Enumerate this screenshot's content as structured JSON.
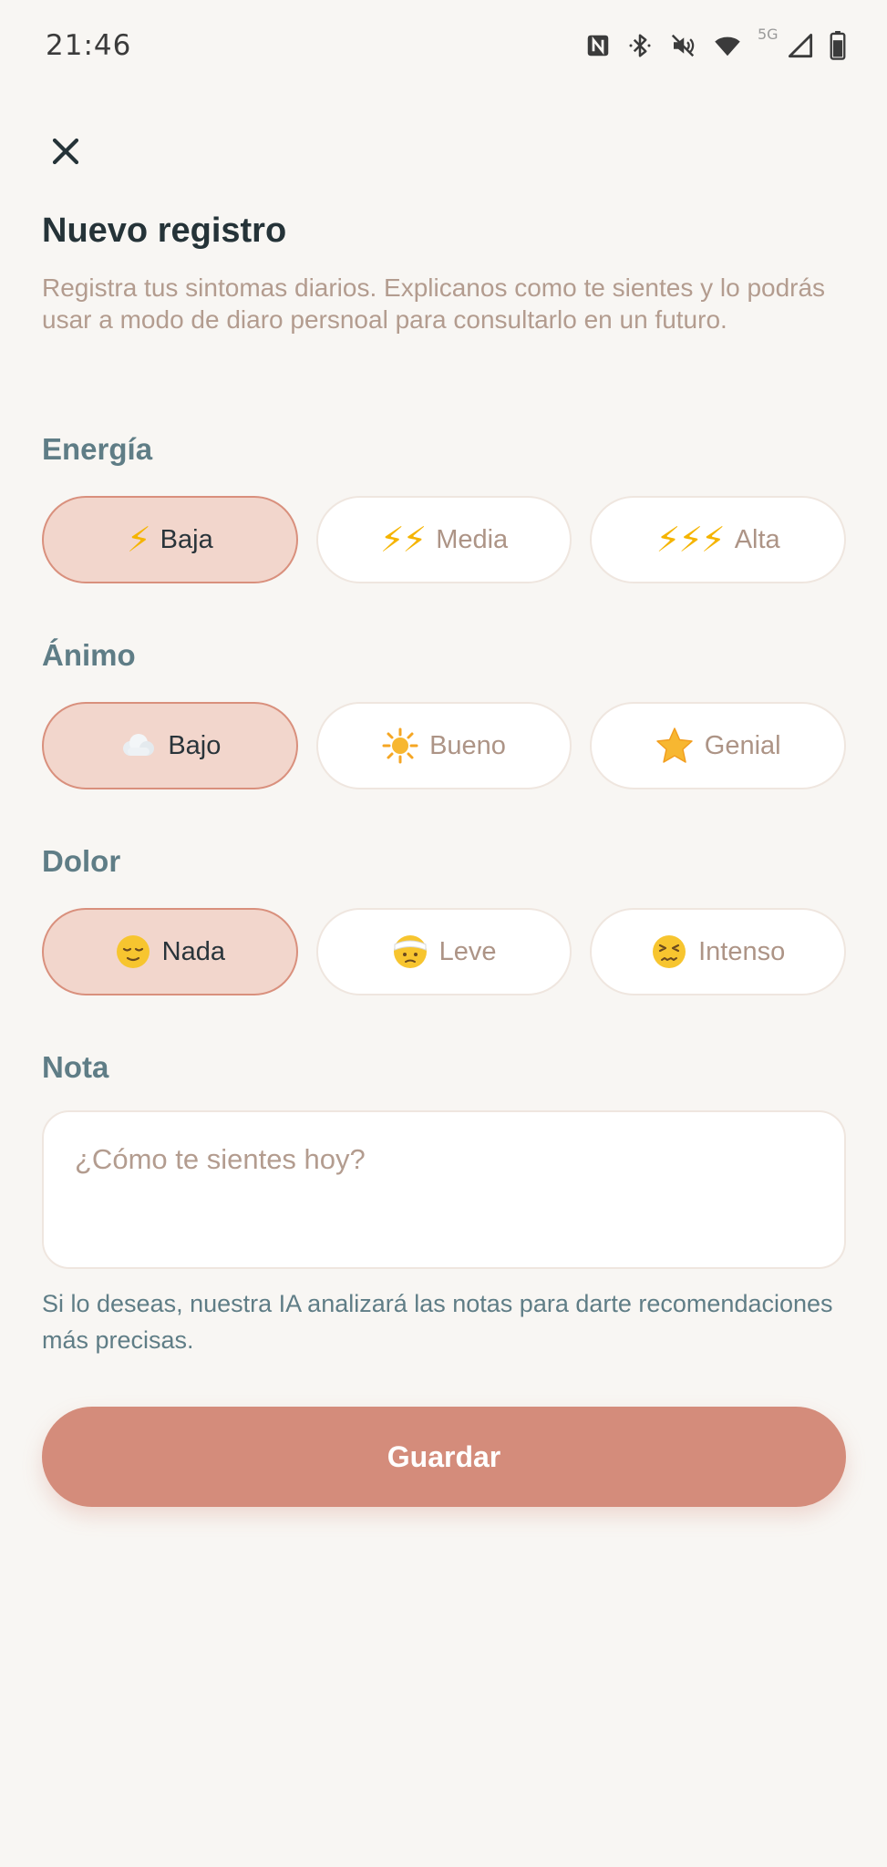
{
  "status_bar": {
    "time": "21:46",
    "network": "5G",
    "icons": [
      "nfc-icon",
      "bluetooth-icon",
      "mute-icon",
      "wifi-icon",
      "signal-icon",
      "battery-icon"
    ]
  },
  "header": {
    "close_icon": "close-icon",
    "title": "Nuevo registro",
    "subtitle": "Registra tus sintomas diarios. Explicanos como te sientes y lo podrás usar a modo de diaro persnoal para consultarlo en un futuro."
  },
  "energy": {
    "label": "Energía",
    "selected": "Baja",
    "options": [
      {
        "label": "Baja",
        "bolts": "⚡",
        "selected": true
      },
      {
        "label": "Media",
        "bolts": "⚡⚡",
        "selected": false
      },
      {
        "label": "Alta",
        "bolts": "⚡⚡⚡",
        "selected": false
      }
    ]
  },
  "mood": {
    "label": "Ánimo",
    "selected": "Bajo",
    "options": [
      {
        "label": "Bajo",
        "icon": "cloud-icon",
        "selected": true
      },
      {
        "label": "Bueno",
        "icon": "sun-icon",
        "selected": false
      },
      {
        "label": "Genial",
        "icon": "star-icon",
        "selected": false
      }
    ]
  },
  "pain": {
    "label": "Dolor",
    "selected": "Nada",
    "options": [
      {
        "label": "Nada",
        "icon": "relieved-face-icon",
        "selected": true
      },
      {
        "label": "Leve",
        "icon": "bandaged-face-icon",
        "selected": false
      },
      {
        "label": "Intenso",
        "icon": "confounded-face-icon",
        "selected": false
      }
    ]
  },
  "note": {
    "label": "Nota",
    "placeholder": "¿Cómo te sientes hoy?",
    "value": "",
    "hint": "Si lo deseas, nuestra IA analizará las notas para darte recomendaciones más precisas."
  },
  "actions": {
    "save_label": "Guardar"
  },
  "colors": {
    "background": "#f8f6f3",
    "accent": "#d48c7b",
    "selected_fill": "#f2d6cc",
    "section_label": "#5f7d86",
    "muted_text": "#b39c8f"
  }
}
